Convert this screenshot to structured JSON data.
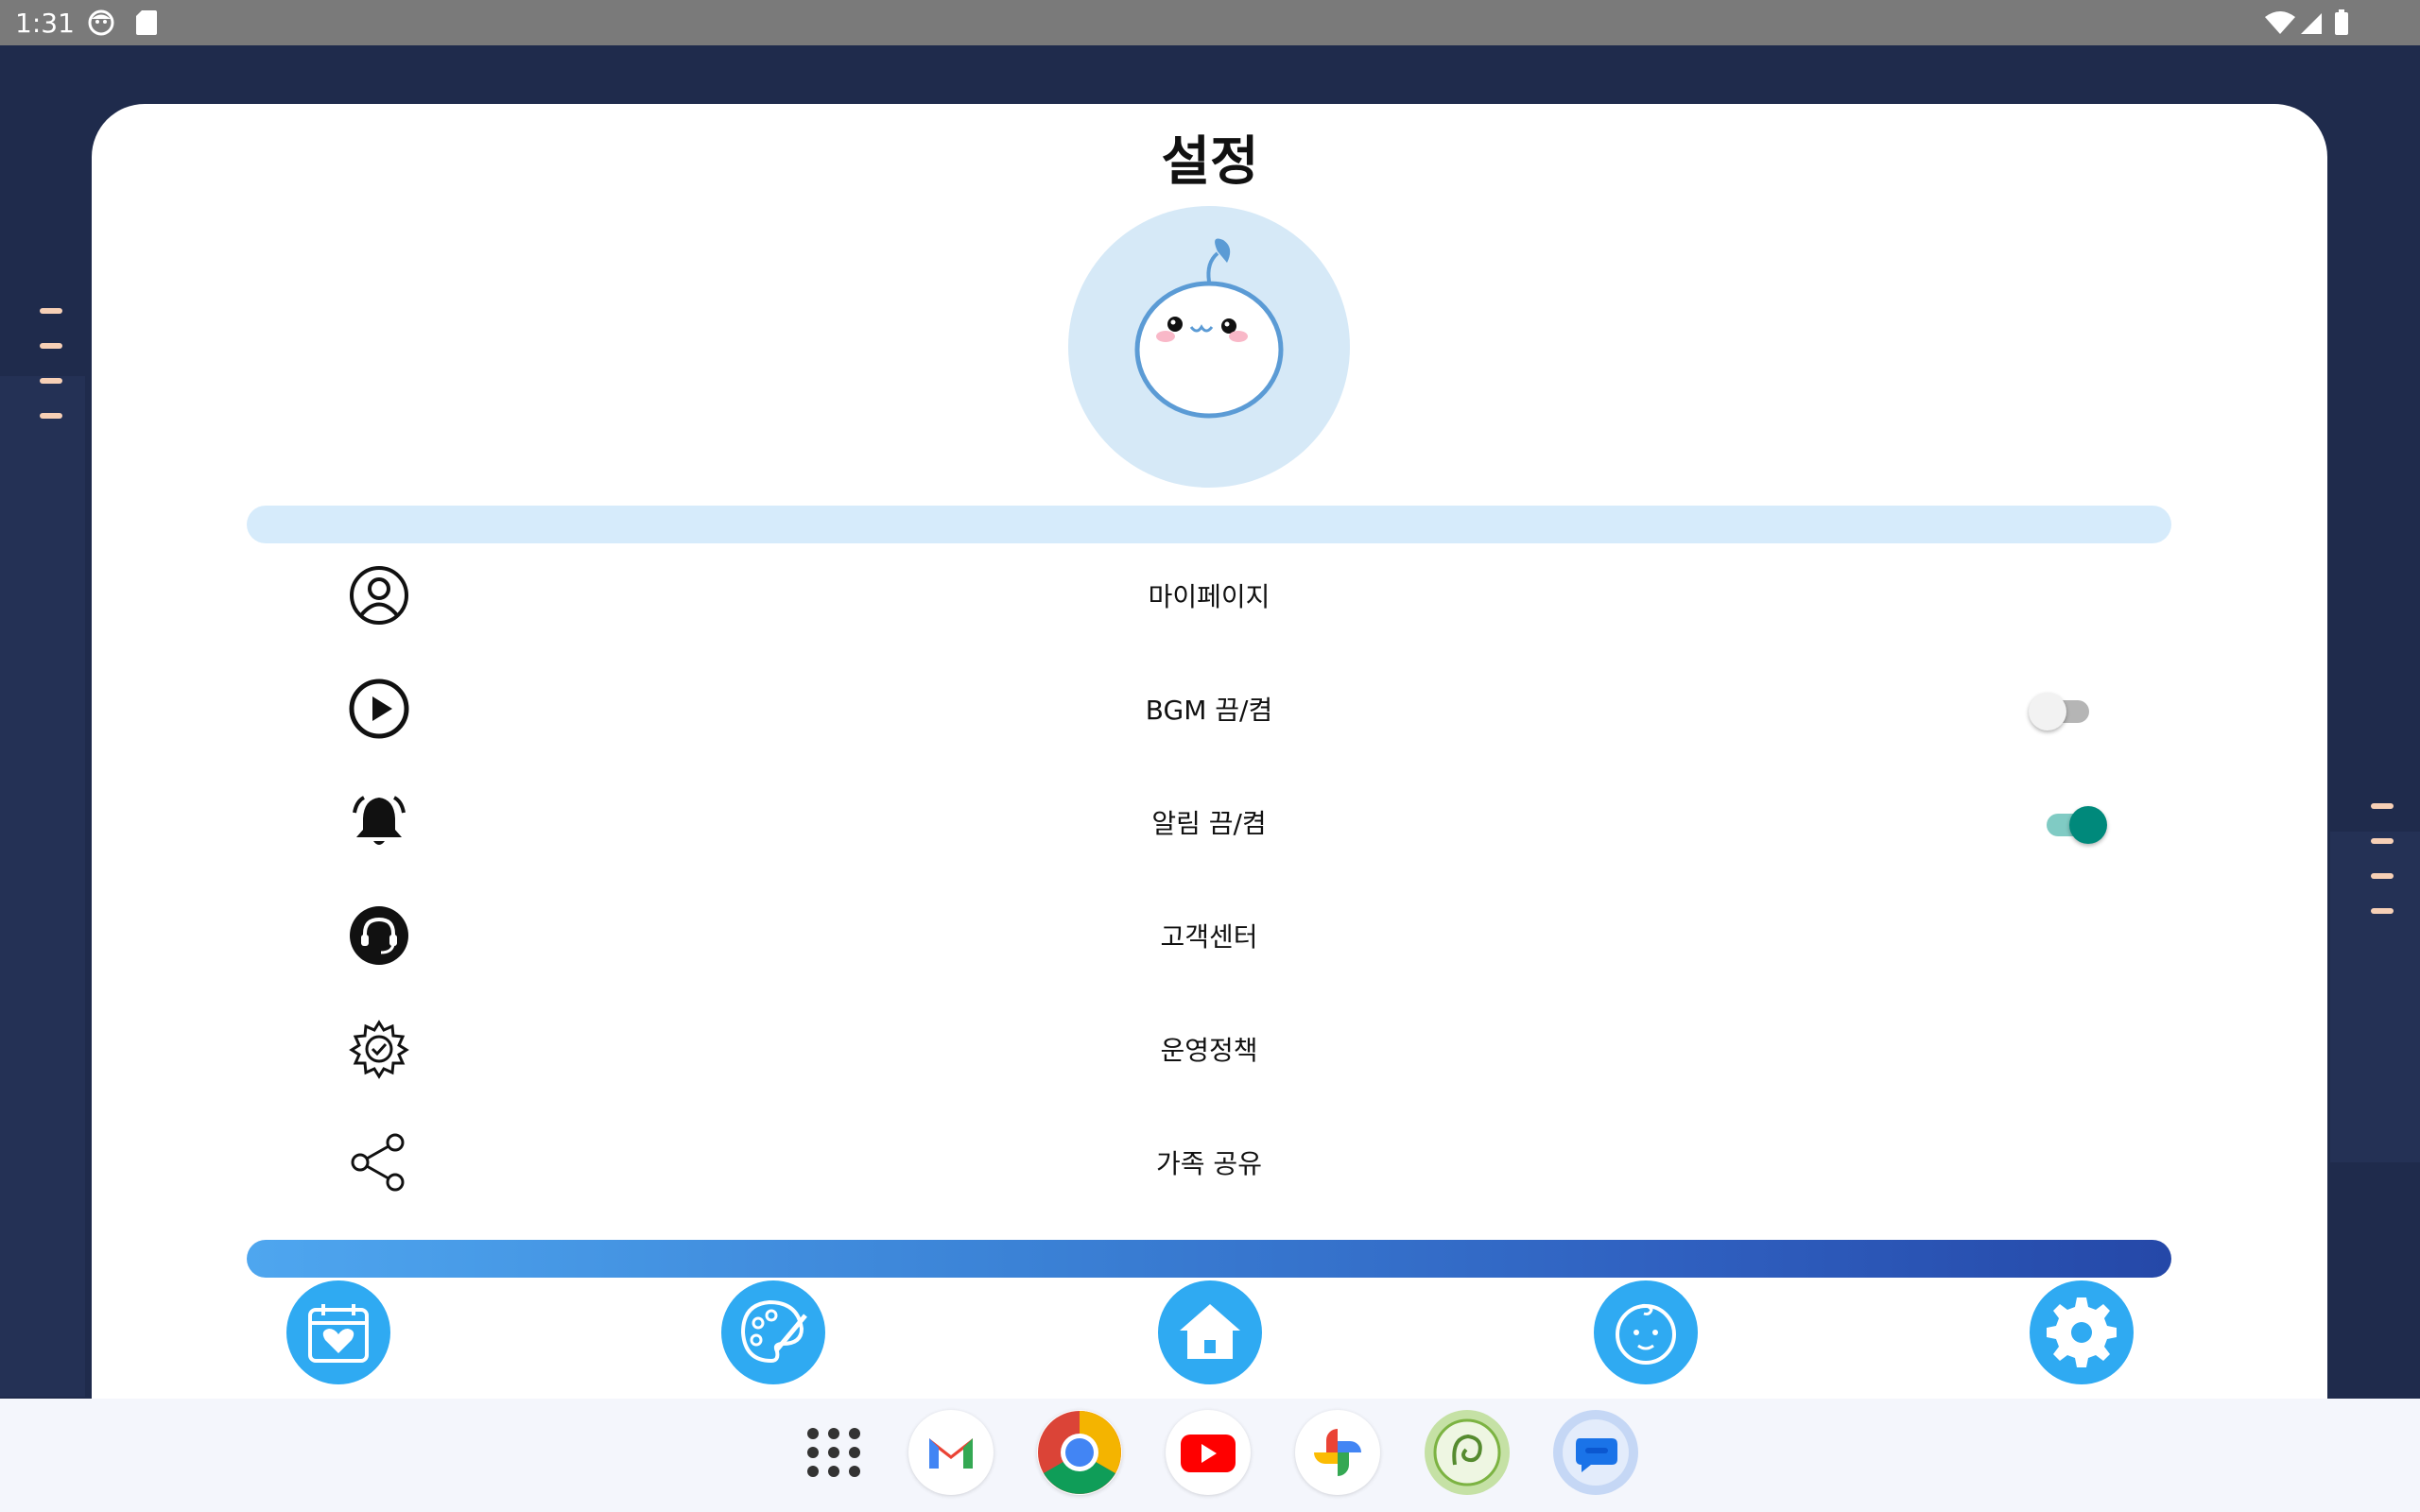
{
  "status_bar": {
    "time": "1:31",
    "left_icons": [
      "face-icon",
      "sd-card-icon"
    ],
    "right_icons": [
      "wifi-icon",
      "signal-icon",
      "battery-icon"
    ]
  },
  "page": {
    "title": "설정",
    "avatar": "sprout-character-avatar"
  },
  "menu": [
    {
      "label": "마이페이지",
      "icon": "user-icon"
    },
    {
      "label": "BGM 끔/켬",
      "icon": "play-circle-icon",
      "toggle": false
    },
    {
      "label": "알림 끔/켬",
      "icon": "bell-icon",
      "toggle": true
    },
    {
      "label": "고객센터",
      "icon": "headset-icon"
    },
    {
      "label": "운영정책",
      "icon": "gear-check-icon"
    },
    {
      "label": "가족 공유",
      "icon": "share-icon"
    }
  ],
  "bottom_nav": [
    {
      "name": "calendar-heart",
      "icon": "calendar-heart-icon"
    },
    {
      "name": "palette",
      "icon": "palette-icon"
    },
    {
      "name": "home",
      "icon": "home-icon"
    },
    {
      "name": "baby",
      "icon": "baby-face-icon"
    },
    {
      "name": "settings",
      "icon": "gear-icon"
    }
  ],
  "dock": [
    "apps-grid-icon",
    "gmail-icon",
    "chrome-icon",
    "youtube-icon",
    "photos-icon",
    "app-icon",
    "messages-icon"
  ],
  "colors": {
    "background": "#1f2b4c",
    "accent": "#2faaf2",
    "toggle_on": "#00897b",
    "top_bar": "#d6ebfb"
  }
}
